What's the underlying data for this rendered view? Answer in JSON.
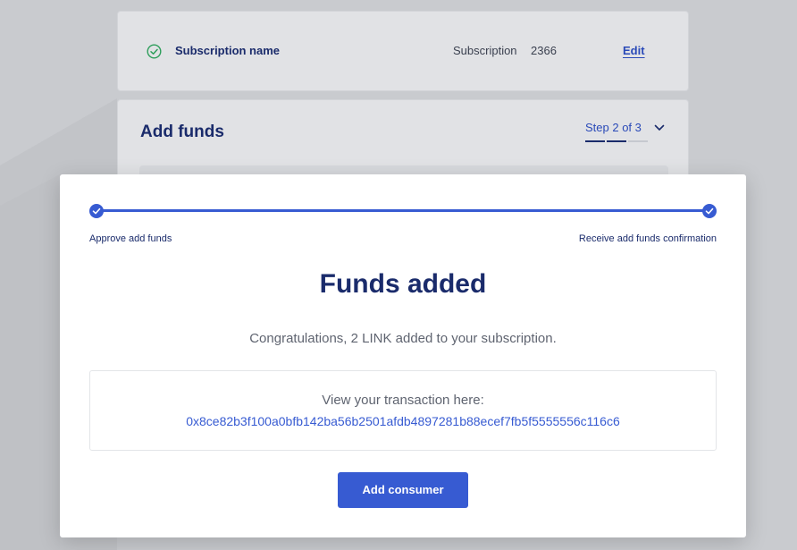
{
  "subscription_card": {
    "name_label": "Subscription name",
    "subscription_label": "Subscription",
    "subscription_value": "2366",
    "edit_label": "Edit"
  },
  "add_funds_card": {
    "title": "Add funds",
    "step_text": "Step 2 of 3"
  },
  "modal": {
    "step_left_label": "Approve add funds",
    "step_right_label": "Receive add funds confirmation",
    "title": "Funds added",
    "subtitle": "Congratulations, 2 LINK added to your subscription.",
    "tx_label": "View your transaction here:",
    "tx_hash": "0x8ce82b3f100a0bfb142ba56b2501afdb4897281b88ecef7fb5f5555556c116c6",
    "cta_label": "Add consumer"
  },
  "colors": {
    "accent": "#375bd2",
    "title": "#1a2b6b",
    "success": "#2e9e5b"
  }
}
